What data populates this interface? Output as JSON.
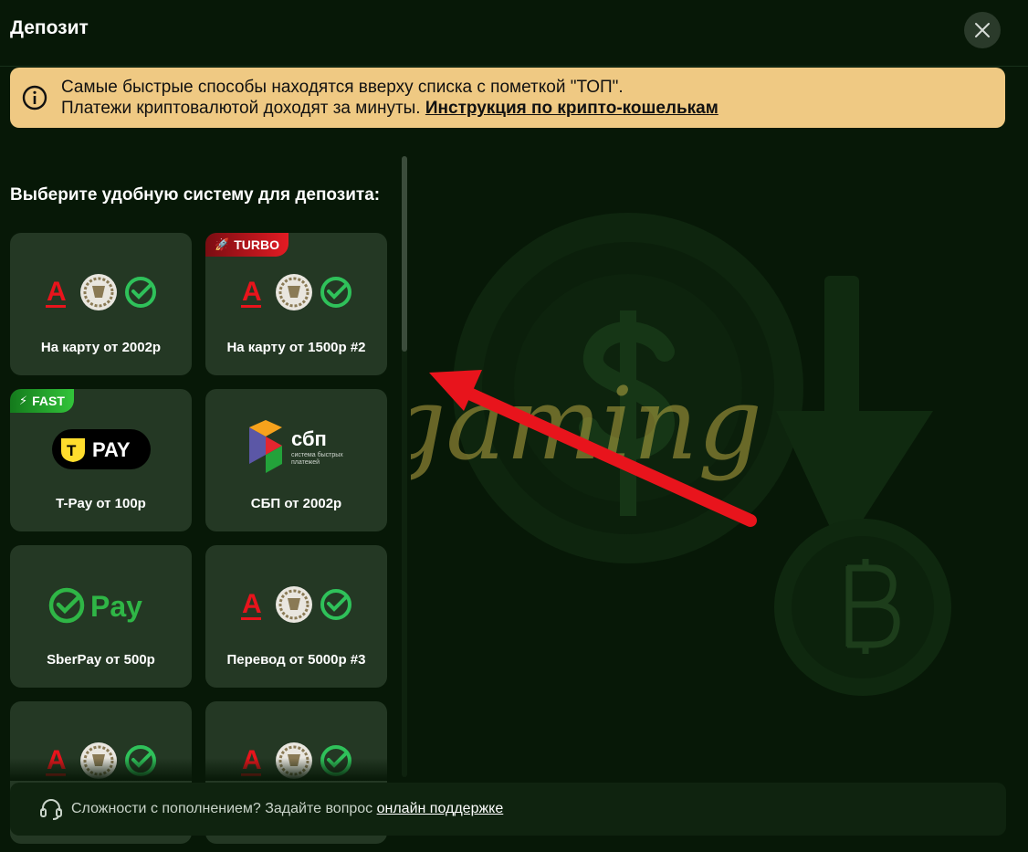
{
  "modal": {
    "title": "Депозит"
  },
  "notice": {
    "line1": "Самые быстрые способы находятся вверху списка с пометкой \"ТОП\".",
    "line2_text": "Платежи криптовалютой доходят за минуты.",
    "line2_link": "Инструкция по крипто-кошелькам"
  },
  "section": {
    "subtitle": "Выберите удобную систему для депозита:"
  },
  "methods": [
    {
      "label": "На карту от 2002р",
      "badge": "",
      "logo": "bank-logos"
    },
    {
      "label": "На карту от 1500р #2",
      "badge": "TURBO",
      "logo": "bank-logos"
    },
    {
      "label": "T-Pay от 100р",
      "badge": "FAST",
      "logo": "tpay-logo"
    },
    {
      "label": "СБП от 2002р",
      "badge": "",
      "logo": "sbp-logo"
    },
    {
      "label": "SberPay от 500р",
      "badge": "",
      "logo": "sberpay-logo"
    },
    {
      "label": "Перевод от 5000р #3",
      "badge": "",
      "logo": "bank-logos"
    },
    {
      "label": "",
      "badge": "",
      "logo": "bank-logos"
    },
    {
      "label": "",
      "badge": "",
      "logo": "bank-logos"
    }
  ],
  "logos": {
    "tpay_text": "PAY",
    "tpay_letter": "T",
    "sbp_title": "сбп",
    "sbp_sub1": "система быстрых",
    "sbp_sub2": "платежей",
    "sberpay_text": "Pay",
    "alfa_letter": "A"
  },
  "footer": {
    "text": "Сложности с пополнением? Задайте вопрос",
    "link": "онлайн поддержке"
  },
  "watermark": "riogaming",
  "colors": {
    "background": "#071807",
    "card": "#243824",
    "notice": "#efc983",
    "turbo": "#e31b23",
    "fast": "#32c43a",
    "arrow": "#e8141c"
  }
}
